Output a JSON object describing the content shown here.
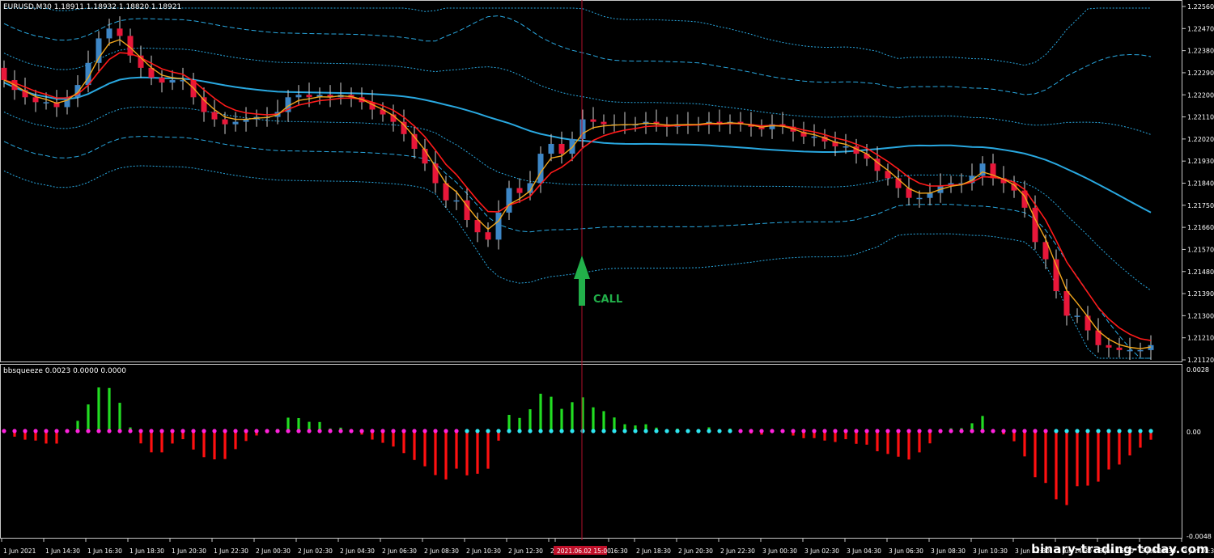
{
  "chart_data": {
    "type": "candlestick",
    "title": "EURUSD,M30  1.18911 1.18932 1.18820 1.18921",
    "price_axis": {
      "min": 1.2112,
      "max": 1.2256,
      "ticks": [
        "1.22560",
        "1.22470",
        "1.22380",
        "1.22290",
        "1.22200",
        "1.22110",
        "1.22020",
        "1.21930",
        "1.21840",
        "1.21750",
        "1.21660",
        "1.21570",
        "1.21480",
        "1.21390",
        "1.21300",
        "1.21210",
        "1.21120"
      ]
    },
    "time_labels": [
      "1 Jun 2021",
      "1 Jun 14:30",
      "1 Jun 16:30",
      "1 Jun 18:30",
      "1 Jun 20:30",
      "1 Jun 22:30",
      "2 Jun 00:30",
      "2 Jun 02:30",
      "2 Jun 04:30",
      "2 Jun 06:30",
      "2 Jun 08:30",
      "2 Jun 10:30",
      "2 Jun 12:30",
      "2",
      "2021.06.02 15:00",
      "16:30",
      "2 Jun 18:30",
      "2 Jun 20:30",
      "2 Jun 22:30",
      "3 Jun 00:30",
      "3 Jun 02:30",
      "3 Jun 04:30",
      "3 Jun 06:30",
      "3 Jun 08:30",
      "3 Jun 10:30",
      "3 Jun 12:30",
      "3 Jun 14:30",
      "3 Jun 16:30",
      "3 Jun 18:30",
      "3 Jun 20:30"
    ],
    "closes": [
      1.2226,
      1.2222,
      1.2219,
      1.2217,
      1.2217,
      1.2215,
      1.2219,
      1.2224,
      1.2233,
      1.2243,
      1.2247,
      1.2244,
      1.2236,
      1.2231,
      1.2227,
      1.2225,
      1.2226,
      1.2226,
      1.2219,
      1.2213,
      1.221,
      1.2208,
      1.2209,
      1.221,
      1.2211,
      1.2211,
      1.2213,
      1.2219,
      1.222,
      1.2219,
      1.222,
      1.2219,
      1.222,
      1.2219,
      1.2217,
      1.2214,
      1.2212,
      1.2209,
      1.2204,
      1.2198,
      1.2192,
      1.2184,
      1.2177,
      1.2177,
      1.2169,
      1.2164,
      1.2161,
      1.2172,
      1.2182,
      1.218,
      1.2184,
      1.2196,
      1.22,
      1.2196,
      1.2202,
      1.221,
      1.2209,
      1.2208,
      1.2208,
      1.2208,
      1.2208,
      1.2209,
      1.2208,
      1.2207,
      1.2208,
      1.2208,
      1.2208,
      1.2209,
      1.2208,
      1.2209,
      1.2208,
      1.2207,
      1.2206,
      1.2208,
      1.2207,
      1.2205,
      1.2203,
      1.2203,
      1.2201,
      1.2199,
      1.2199,
      1.2196,
      1.2194,
      1.2189,
      1.2186,
      1.2182,
      1.2178,
      1.2178,
      1.218,
      1.2183,
      1.2184,
      1.2184,
      1.2187,
      1.2192,
      1.2186,
      1.2184,
      1.2181,
      1.2174,
      1.216,
      1.2153,
      1.214,
      1.213,
      1.213,
      1.2124,
      1.2118,
      1.2117,
      1.2116,
      1.2116,
      1.2116,
      1.2118
    ],
    "indicator": {
      "label": "bbsqueeze 0.0023 0.0000 0.0000",
      "axis_top": "0.0028",
      "axis_zero": "0.00",
      "axis_bottom": "-0.0048"
    },
    "annotation": {
      "text": "CALL",
      "color": "#22b04a"
    },
    "colors": {
      "bull": "#3d86c6",
      "bear": "#e8173a",
      "ema_fast": "#f2a61c",
      "ema_slow": "#ff1a1a",
      "band": "#29a8e0",
      "hist_pos": "#22dd22",
      "hist_neg": "#ff1010",
      "dot_cyan": "#2ee6f2",
      "dot_magenta": "#ff22dd",
      "vline": "#b0102a"
    }
  },
  "watermark": "binary-trading-today.com"
}
